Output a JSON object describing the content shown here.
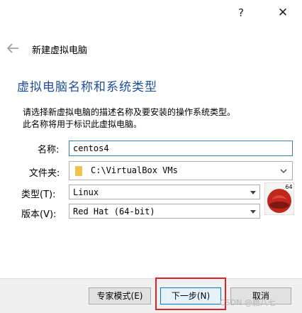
{
  "titlebar": {
    "help_glyph": "?",
    "close_glyph": "✕"
  },
  "wizard": {
    "title": "新建虚拟电脑"
  },
  "section_title": "虚拟电脑名称和系统类型",
  "description": [
    "请选择新虚拟电脑的描述名称及要安装的操作系统类型。",
    "此名称将用于标识此虚拟电脑。"
  ],
  "form": {
    "name_label": "名称:",
    "name_value": "centos4",
    "folder_label": "文件夹:",
    "folder_value": "C:\\VirtualBox VMs",
    "type_label": "类型(T):",
    "type_value": "Linux",
    "version_label": "版本(V):",
    "version_value": "Red Hat (64-bit)",
    "os_icon_badge": "64"
  },
  "buttons": {
    "expert": "专家模式(E)",
    "next": "下一步(N)",
    "cancel": "取消"
  },
  "watermark": "CSDN @腊八七",
  "colors": {
    "section_title": "#1f4e9a",
    "highlight": "#e0202a",
    "focus_border": "#3c7fb1",
    "os_icon_red": "#c0281d"
  },
  "icons": [
    "back-arrow-icon",
    "folder-icon",
    "chevron-down-icon",
    "redhat-os-icon"
  ]
}
